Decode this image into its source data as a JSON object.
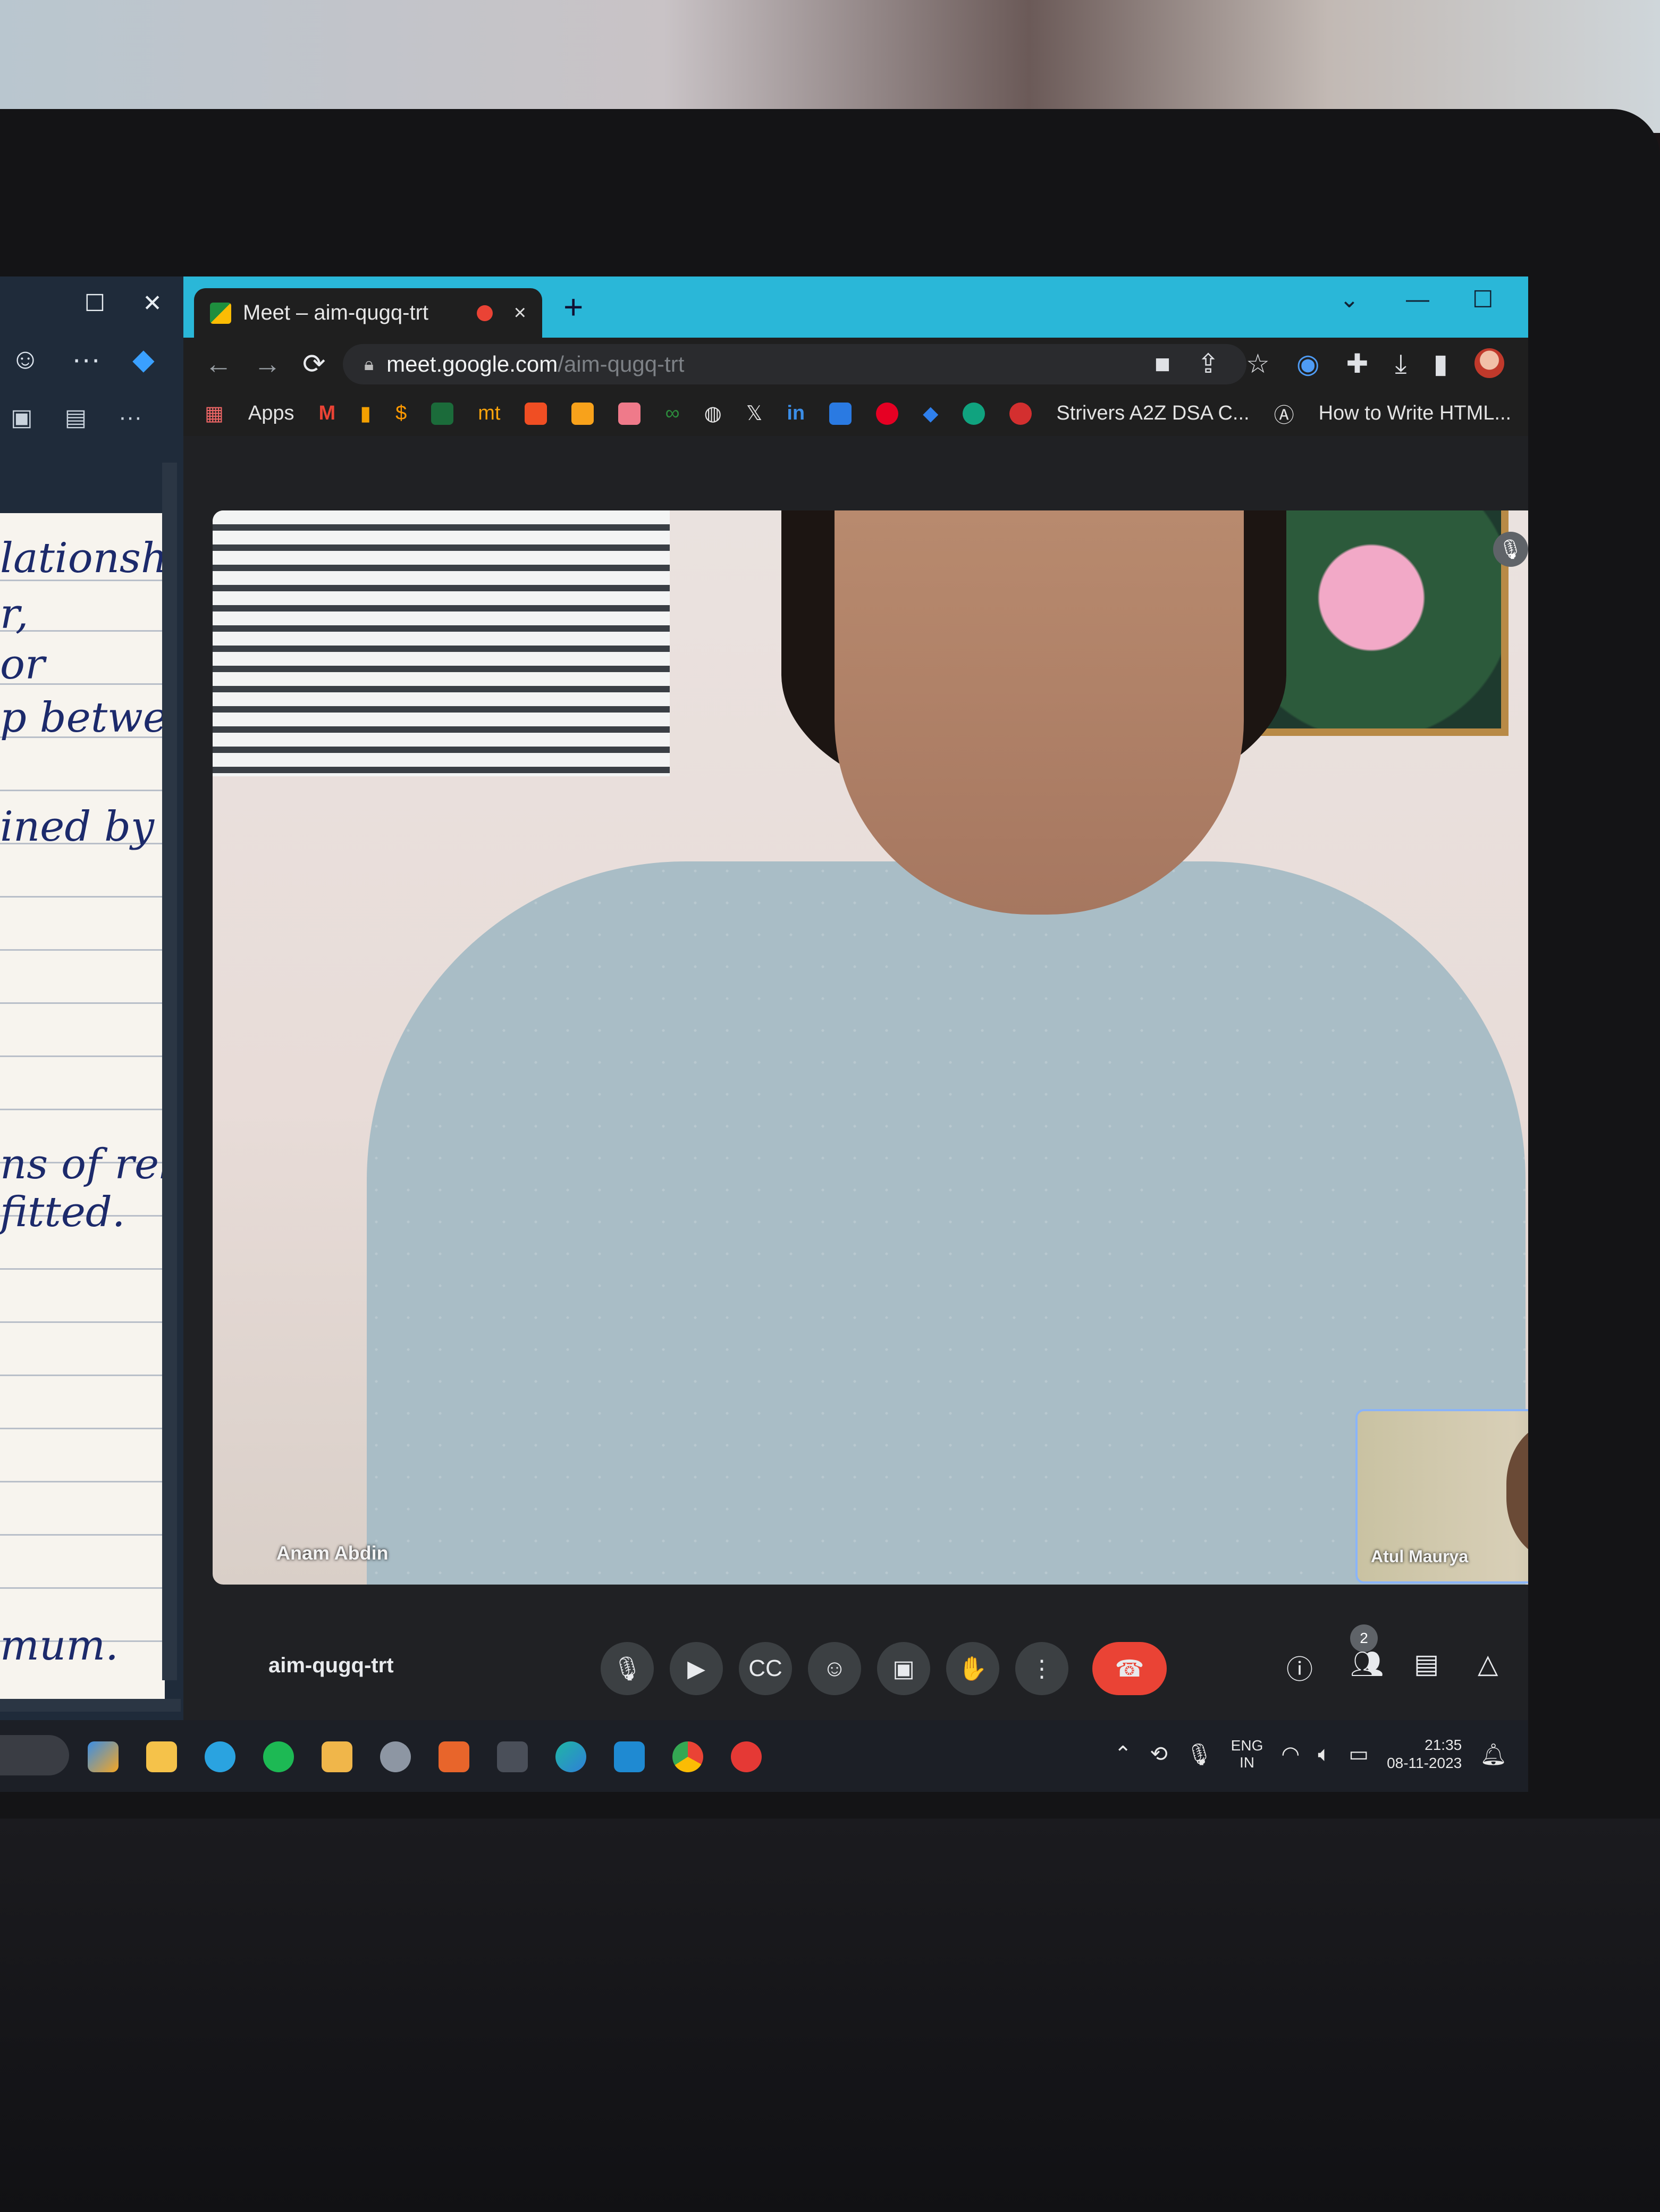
{
  "onenote": {
    "toolbar": {
      "more_label": "···"
    },
    "toolbar2": {
      "more_label": "···"
    },
    "lines": [
      "lationship",
      "r,",
      "or",
      "p between",
      "ined by",
      "ns of relate",
      "fitted.",
      "mum."
    ]
  },
  "browser": {
    "tab": {
      "title": "Meet – aim-qugq-trt",
      "close": "×"
    },
    "new_tab": "+",
    "url_host": "meet.google.com",
    "url_path": "/aim-qugq-trt",
    "bookmarks": {
      "apps_label": "Apps",
      "strivers_label": "Strivers A2Z DSA C...",
      "howto_label": "How to Write HTML...",
      "overflow": "»",
      "mt_label": "mt"
    }
  },
  "meet": {
    "main_participant": "Anam Abdin",
    "pip_participant": "Atul Maurya",
    "meeting_code": "aim-qugq-trt",
    "participants_count": "2"
  },
  "taskbar": {
    "language_line1": "ENG",
    "language_line2": "IN",
    "time": "21:35",
    "date": "08-11-2023"
  },
  "colors": {
    "tabstrip": "#2ab7d8",
    "end_call": "#ea4335",
    "pip_border": "#8ab4f8"
  }
}
